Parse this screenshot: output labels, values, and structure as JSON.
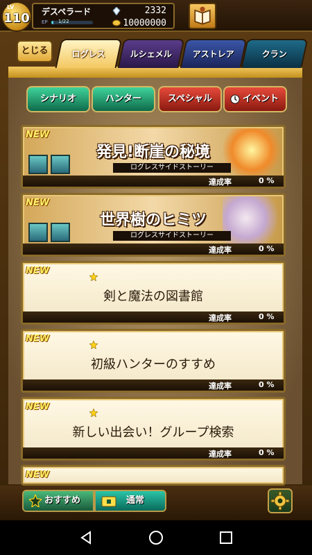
{
  "player": {
    "level_label": "LV",
    "level": "110",
    "name": "デスペラード",
    "ep_label": "EP",
    "ep_value": "1/22",
    "ep_fraction": 0.05,
    "gems": "2332",
    "gold": "10000000"
  },
  "nav": {
    "close_label": "とじる",
    "tabs": [
      {
        "label": "ログレス",
        "active": true
      },
      {
        "label": "ルシェメル",
        "active": false
      },
      {
        "label": "アストレア",
        "active": false
      },
      {
        "label": "クラン",
        "active": false
      }
    ]
  },
  "categories": [
    {
      "label": "シナリオ"
    },
    {
      "label": "ハンター"
    },
    {
      "label": "スペシャル"
    },
    {
      "label": "イベント"
    }
  ],
  "quests": [
    {
      "new": "NEW",
      "title": "発見!断崖の秘境",
      "subtitle": "ログレスサイドストーリー",
      "rate_label": "達成率",
      "rate": "0 %"
    },
    {
      "new": "NEW",
      "title": "世界樹のヒミツ",
      "subtitle": "ログレスサイドストーリー",
      "rate_label": "達成率",
      "rate": "0 %"
    },
    {
      "new": "NEW",
      "title": "剣と魔法の図書館",
      "rate_label": "達成率",
      "rate": "0 %"
    },
    {
      "new": "NEW",
      "title": "初級ハンターのすすめ",
      "rate_label": "達成率",
      "rate": "0 %"
    },
    {
      "new": "NEW",
      "title": "新しい出会い！グループ検索",
      "rate_label": "達成率",
      "rate": "0 %"
    },
    {
      "new": "NEW"
    }
  ],
  "bottom": {
    "recommend_label": "おすすめ",
    "normal_label": "通常"
  },
  "colors": {
    "gold": "#c2901c",
    "new_text": "#fff26a",
    "category_green": "#0f6a4a",
    "category_red": "#8a1a10"
  },
  "icons": [
    "gem-icon",
    "gold-coin-icon",
    "book-icon",
    "star-icon",
    "clock-icon",
    "gear-icon",
    "back-icon",
    "home-icon",
    "recents-icon"
  ]
}
